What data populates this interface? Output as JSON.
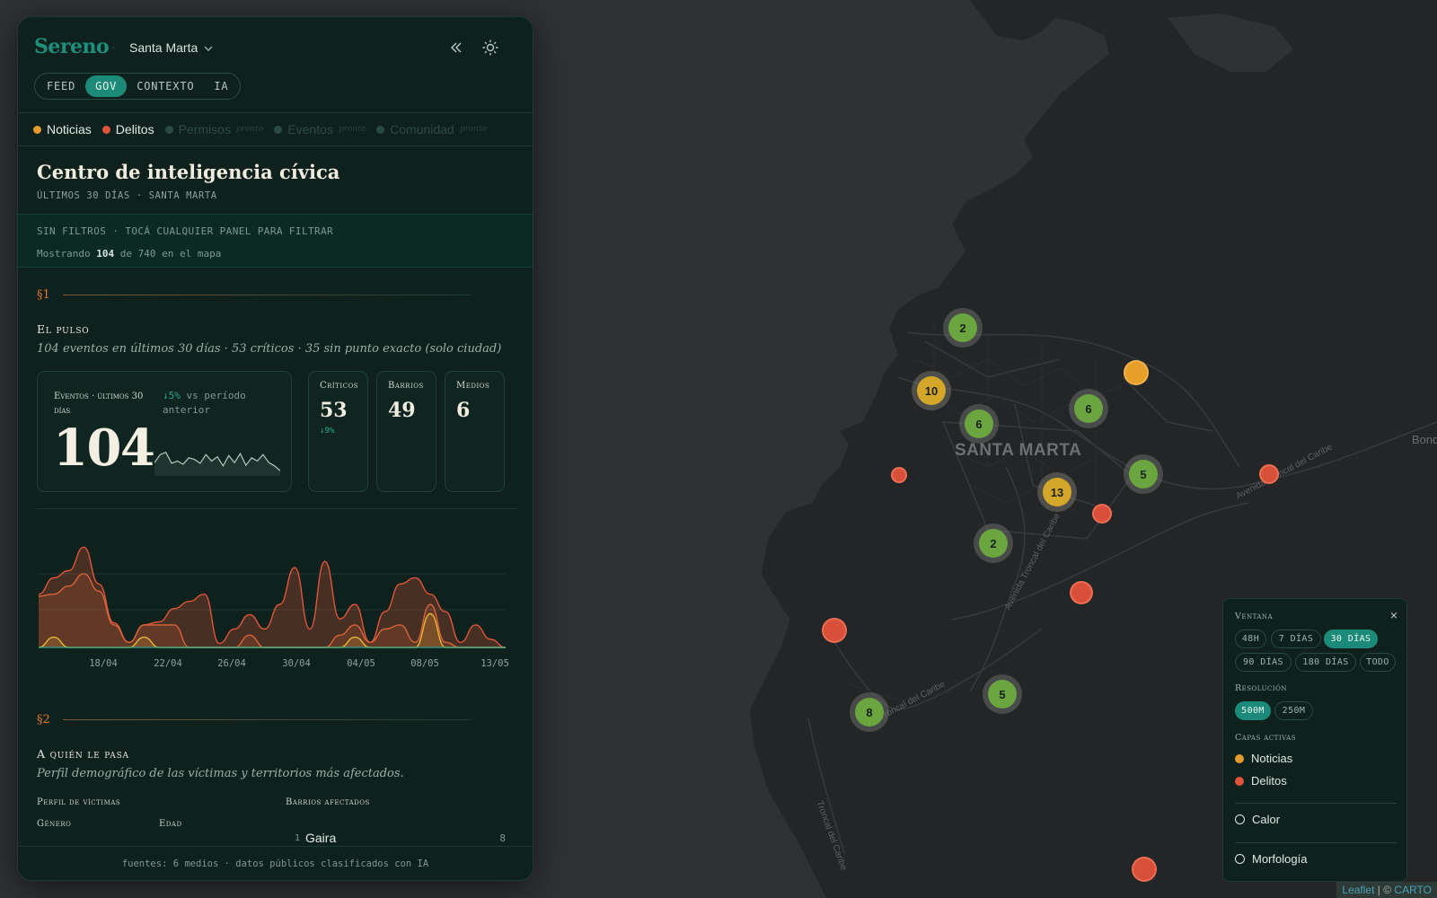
{
  "map": {
    "city_label": "SANTA MARTA",
    "road_labels": [
      "Avenida Troncal del Caribe",
      "Avenida Troncal del Caribe",
      "Troncal del Caribe",
      "Troncal del Caribe",
      "Bond"
    ],
    "clusters": [
      {
        "count": "2",
        "color": "green"
      },
      {
        "count": "10",
        "color": "yellow"
      },
      {
        "count": "6",
        "color": "green"
      },
      {
        "count": "6",
        "color": "green"
      },
      {
        "count": "13",
        "color": "yellow"
      },
      {
        "count": "5",
        "color": "green"
      },
      {
        "count": "2",
        "color": "green"
      },
      {
        "count": "5",
        "color": "green"
      },
      {
        "count": "8",
        "color": "green"
      }
    ],
    "attribution": {
      "leaflet": "Leaflet",
      "carto": "CARTO",
      "separator": "| ©"
    }
  },
  "header": {
    "logo": "Sereno",
    "separator": "·",
    "city": "Santa Marta"
  },
  "tabs": [
    {
      "label": "FEED",
      "active": false
    },
    {
      "label": "GOV",
      "active": true
    },
    {
      "label": "CONTEXTO",
      "active": false
    },
    {
      "label": "IA",
      "active": false
    }
  ],
  "layers": [
    {
      "label": "Noticias",
      "color": "#e39a2a",
      "enabled": true,
      "note": ""
    },
    {
      "label": "Delitos",
      "color": "#e0553a",
      "enabled": true,
      "note": ""
    },
    {
      "label": "Permisos",
      "color": "#2a4a42",
      "enabled": false,
      "note": "pronto"
    },
    {
      "label": "Eventos",
      "color": "#2a4a42",
      "enabled": false,
      "note": "pronto"
    },
    {
      "label": "Comunidad",
      "color": "#2a4a42",
      "enabled": false,
      "note": "pronto"
    }
  ],
  "main": {
    "title": "Centro de inteligencia cívica",
    "subtitle": "ÚLTIMOS 30 DÍAS · SANTA MARTA",
    "filter_line": "SIN FILTROS · TOCÁ CUALQUIER PANEL PARA FILTRAR",
    "showing_prefix": "Mostrando",
    "showing_count": "104",
    "showing_suffix": "de 740 en el mapa"
  },
  "section1": {
    "num": "§1",
    "title": "El pulso",
    "desc": "104 eventos en últimos 30 días · 53 críticos · 35 sin punto exacto (solo ciudad)",
    "big_card": {
      "label": "Eventos · últimos 30 días",
      "value": "104",
      "delta": "↓5%",
      "delta_suffix": "vs período anterior"
    },
    "cards": [
      {
        "label": "Críticos",
        "value": "53",
        "delta": "↓9%"
      },
      {
        "label": "Barrios",
        "value": "49",
        "delta": ""
      },
      {
        "label": "Medios",
        "value": "6",
        "delta": ""
      }
    ]
  },
  "chart_data": {
    "type": "area",
    "x_tick_labels": [
      "18/04",
      "22/04",
      "26/04",
      "30/04",
      "04/05",
      "08/05",
      "13/05"
    ],
    "series": [
      {
        "name": "",
        "color": "#e0553a",
        "values": [
          0.52,
          0.68,
          0.75,
          0.98,
          0.62,
          0.24,
          0.05,
          0.22,
          0.25,
          0.38,
          0.45,
          0.52,
          0.04,
          0.18,
          0.32,
          0.18,
          0.42,
          0.78,
          0.18,
          0.84,
          0.28,
          0.42,
          0.05,
          0.35,
          0.62,
          0.68,
          0.52,
          0.35,
          0.05,
          0.22,
          0.08,
          0.0
        ]
      },
      {
        "name": "",
        "color": "#d9643a",
        "values": [
          0.5,
          0.52,
          0.6,
          0.72,
          0.55,
          0.22,
          0.05,
          0.22,
          0.22,
          0.22,
          0.0,
          0.0,
          0.0,
          0.0,
          0.12,
          0.0,
          0.0,
          0.0,
          0.0,
          0.0,
          0.12,
          0.22,
          0.05,
          0.18,
          0.22,
          0.05,
          0.42,
          0.05,
          0.0,
          0.0,
          0.0,
          0.0
        ]
      },
      {
        "name": "",
        "color": "#e6b83a",
        "values": [
          0.0,
          0.1,
          0.0,
          0.0,
          0.0,
          0.0,
          0.0,
          0.1,
          0.0,
          0.0,
          0.0,
          0.0,
          0.0,
          0.0,
          0.0,
          0.0,
          0.0,
          0.0,
          0.0,
          0.0,
          0.0,
          0.1,
          0.0,
          0.0,
          0.0,
          0.0,
          0.33,
          0.0,
          0.0,
          0.0,
          0.0,
          0.0
        ]
      }
    ],
    "sparkline": [
      0.3,
      0.55,
      0.62,
      0.28,
      0.35,
      0.25,
      0.45,
      0.4,
      0.28,
      0.55,
      0.35,
      0.48,
      0.2,
      0.52,
      0.3,
      0.58,
      0.22,
      0.45,
      0.35,
      0.55,
      0.3,
      0.2,
      0.05
    ]
  },
  "section2": {
    "num": "§2",
    "title": "A quién le pasa",
    "desc": "Perfil demográfico de las víctimas y territorios más afectados.",
    "victims_label": "Perfil de víctimas",
    "gender_label": "Género",
    "age_label": "Edad",
    "barrios_label": "Barrios afectados",
    "barrios": [
      {
        "rank": "1",
        "name": "Gaira",
        "count": "8"
      }
    ]
  },
  "footer": "fuentes: 6 medios · datos públicos clasificados con IA",
  "controls": {
    "window_label": "Ventana",
    "close": "×",
    "window_options": [
      "48H",
      "7 DÍAS",
      "30 DÍAS",
      "90 DÍAS",
      "180 DÍAS",
      "TODO"
    ],
    "window_selected": "30 DÍAS",
    "resolution_label": "Resolución",
    "resolution_options": [
      "500M",
      "250M"
    ],
    "resolution_selected": "500M",
    "layers_label": "Capas activas",
    "active_layers": [
      {
        "label": "Noticias",
        "color": "#e39a2a"
      },
      {
        "label": "Delitos",
        "color": "#e0553a"
      }
    ],
    "heat_label": "Calor",
    "morph_label": "Morfología"
  },
  "colors": {
    "accent": "#1c8a78",
    "panel_bg": "#0f211d",
    "map_bg": "#2f3133"
  }
}
